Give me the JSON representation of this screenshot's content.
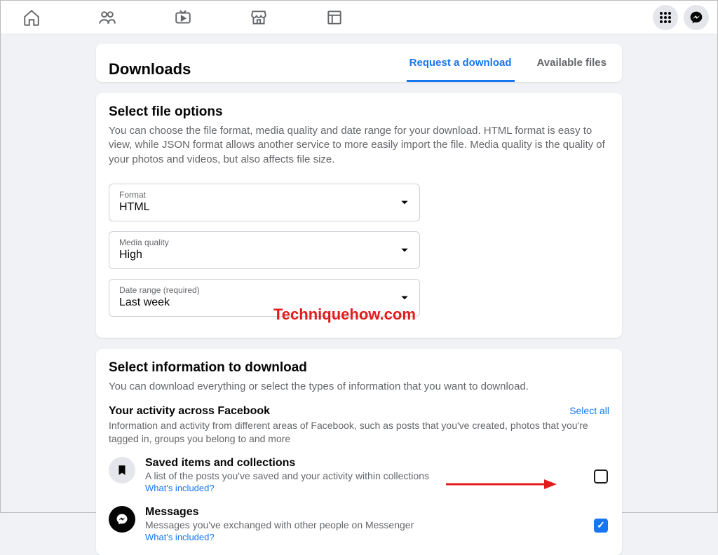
{
  "tabs": {
    "request": "Request a download",
    "available": "Available files"
  },
  "page_title": "Downloads",
  "file_options": {
    "title": "Select file options",
    "desc": "You can choose the file format, media quality and date range for your download. HTML format is easy to view, while JSON format allows another service to more easily import the file. Media quality is the quality of your photos and videos, but also affects file size.",
    "format_label": "Format",
    "format_value": "HTML",
    "quality_label": "Media quality",
    "quality_value": "High",
    "range_label": "Date range (required)",
    "range_value": "Last week"
  },
  "info_section": {
    "title": "Select information to download",
    "desc": "You can download everything or select the types of information that you want to download.",
    "activity_title": "Your activity across Facebook",
    "activity_desc": "Information and activity from different areas of Facebook, such as posts that you've created, photos that you're tagged in, groups you belong to and more",
    "select_all": "Select all"
  },
  "items": {
    "saved": {
      "title": "Saved items and collections",
      "desc": "A list of the posts you've saved and your activity within collections",
      "link": "What's included?"
    },
    "messages": {
      "title": "Messages",
      "desc": "Messages you've exchanged with other people on Messenger",
      "link": "What's included?"
    }
  },
  "watermark": "Techniquehow.com"
}
